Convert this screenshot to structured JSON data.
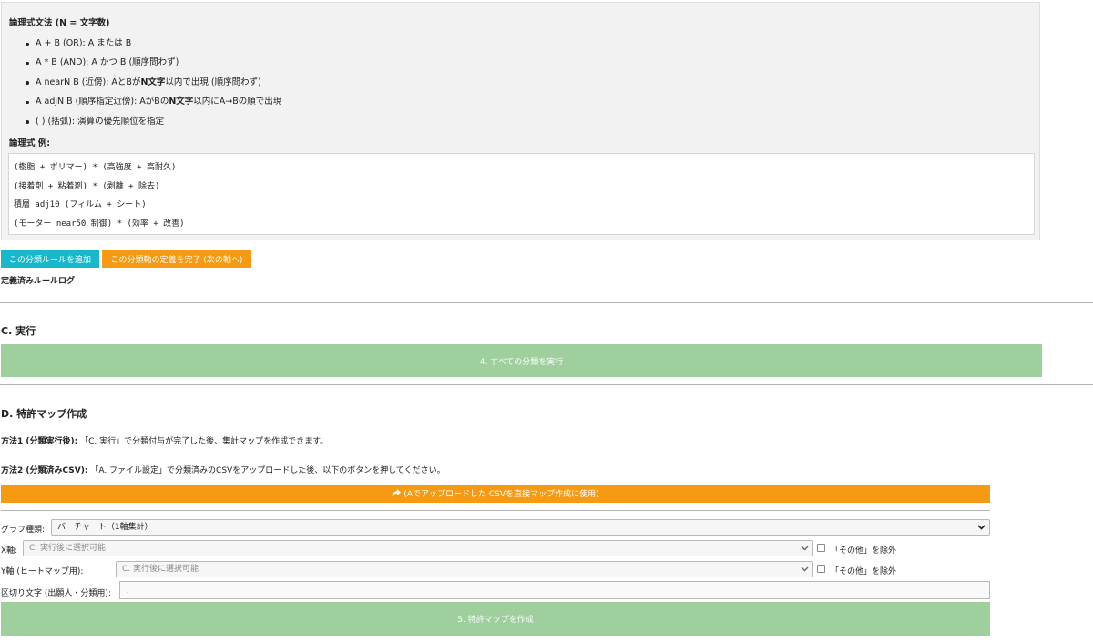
{
  "syntax_help": {
    "title": "論理式文法 (N = 文字数)",
    "items": [
      {
        "pre": "A + B (OR): A または B",
        "bold": "",
        "post": ""
      },
      {
        "pre": "A * B (AND): A かつ B (順序問わず)",
        "bold": "",
        "post": ""
      },
      {
        "pre": "A nearN B (近傍): AとBが",
        "bold": "N文字",
        "post": "以内で出現 (順序問わず)"
      },
      {
        "pre": "A adjN B (順序指定近傍): AがBの",
        "bold": "N文字",
        "post": "以内にA→Bの順で出現"
      },
      {
        "pre": "( ) (括弧): 演算の優先順位を指定",
        "bold": "",
        "post": ""
      }
    ],
    "example_title": "論理式 例:",
    "examples": [
      "(樹脂 + ポリマー) * (高強度 + 高耐久)",
      "(接着剤 + 粘着剤) * (剥離 + 除去)",
      "積層 adj10 (フィルム + シート)",
      "(モーター near50 制御) * (効率 + 改善)"
    ]
  },
  "rule_buttons": {
    "add": "この分類ルールを追加",
    "complete": "この分類軸の定義を完了 (次の軸へ)"
  },
  "rule_log_title": "定義済みルールログ",
  "section_c": {
    "title": "C. 実行",
    "run_button": "4. すべての分類を実行"
  },
  "section_d": {
    "title": "D. 特許マップ作成",
    "method1_label": "方法1 (分類実行後):",
    "method1_text": "「C. 実行」で分類付与が完了した後、集計マップを作成できます。",
    "method2_label": "方法2 (分類済みCSV):",
    "method2_text": "「A. ファイル設定」で分類済みのCSVをアップロードした後、以下のボタンを押してください。",
    "use_csv_button": "(Aでアップロードした CSVを直接マップ作成に使用)",
    "use_csv_icon": "share-arrow-icon",
    "graph_type_label": "グラフ種類:",
    "graph_type_value": "バーチャート（1軸集計）",
    "x_axis_label": "X軸:",
    "x_axis_placeholder": "C. 実行後に選択可能",
    "y_axis_label": "Y軸 (ヒートマップ用):",
    "y_axis_placeholder": "C. 実行後に選択可能",
    "exclude_other_label": "「その他」を除外",
    "delimiter_label": "区切り文字 (出願人・分類用):",
    "delimiter_value": ";",
    "create_map_button": "5. 特許マップを作成"
  },
  "colors": {
    "cyan_button": "#17b8cc",
    "orange_button": "#f59a12",
    "green_button": "#9ecf9c",
    "help_background": "#f2f2f2"
  }
}
